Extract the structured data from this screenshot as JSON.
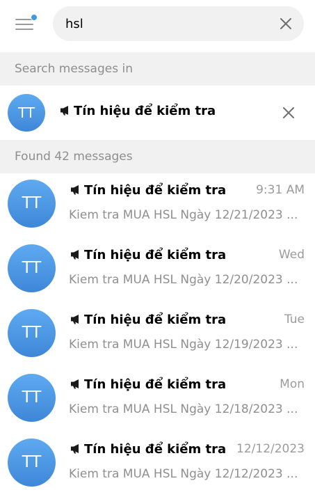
{
  "search": {
    "query": "hsl"
  },
  "search_in_label": "Search messages in",
  "chat_filter": {
    "avatar_initials": "TT",
    "name": "Tín hiệu để kiểm tra"
  },
  "found_label": "Found 42 messages",
  "results": [
    {
      "avatar_initials": "TT",
      "title": "Tín hiệu để kiểm tra",
      "time": "9:31 AM",
      "preview": "Kiem tra MUA HSL Ngày 12/21/2023 ..."
    },
    {
      "avatar_initials": "TT",
      "title": "Tín hiệu để kiểm tra",
      "time": "Wed",
      "preview": "Kiem tra MUA HSL Ngày 12/20/2023 ..."
    },
    {
      "avatar_initials": "TT",
      "title": "Tín hiệu để kiểm tra",
      "time": "Tue",
      "preview": "Kiem tra MUA HSL Ngày 12/19/2023 ..."
    },
    {
      "avatar_initials": "TT",
      "title": "Tín hiệu để kiểm tra",
      "time": "Mon",
      "preview": "Kiem tra MUA HSL Ngày 12/18/2023 ..."
    },
    {
      "avatar_initials": "TT",
      "title": "Tín hiệu để kiểm tra",
      "time": "12/12/2023",
      "preview": "Kiem tra MUA HSL Ngày 12/12/2023 ..."
    }
  ],
  "icons": {
    "menu": "hamburger-menu-icon",
    "notification_dot": "notification-dot-icon",
    "clear": "close-icon",
    "channel": "megaphone-icon"
  },
  "colors": {
    "accent": "#3d9be4",
    "avatar_gradient_top": "#5eaaf0",
    "avatar_gradient_bottom": "#3e87d8",
    "section_background": "#f1f1f1",
    "secondary_text": "#8e8e8e"
  }
}
